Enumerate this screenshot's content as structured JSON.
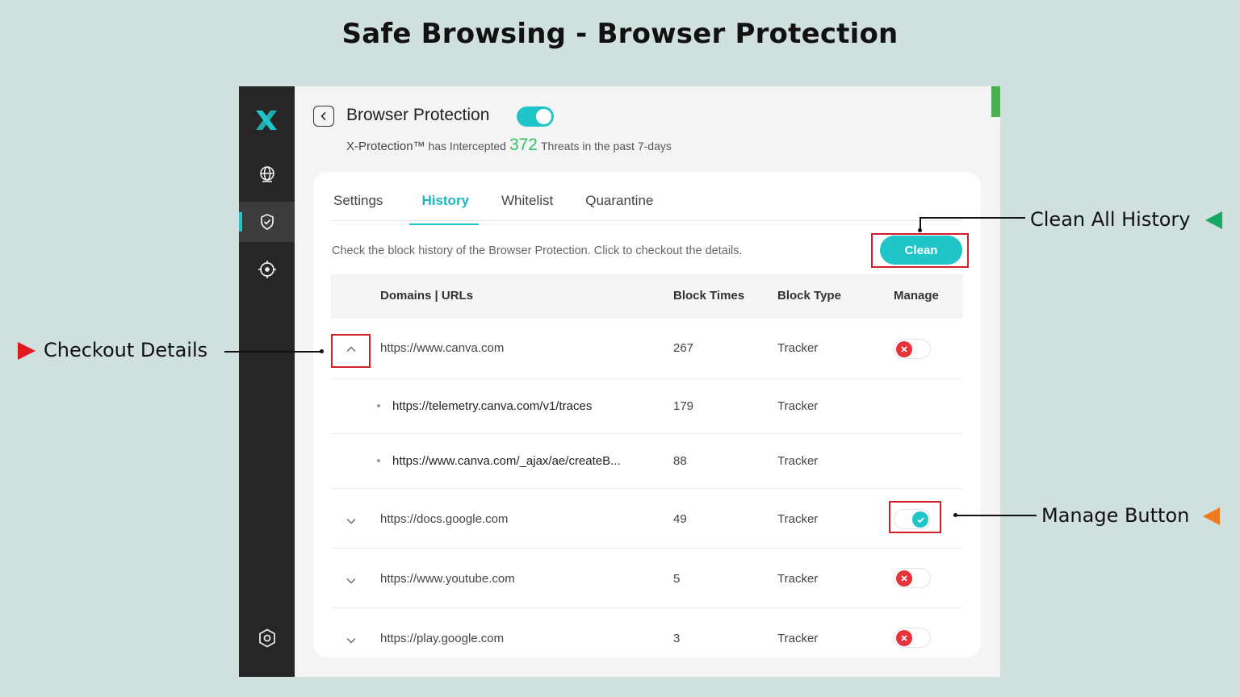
{
  "slide": {
    "title": "Safe Browsing - Browser Protection"
  },
  "colors": {
    "accent": "#20c5c9",
    "count_green": "#35c26a",
    "danger": "#e8323a",
    "annotation_red": "#d0212a"
  },
  "sidebar": {
    "items": [
      {
        "icon": "x-logo-icon"
      },
      {
        "icon": "globe-icon"
      },
      {
        "icon": "shield-check-icon",
        "active": true
      },
      {
        "icon": "crosshair-icon"
      },
      {
        "icon": "settings-hexagon-icon"
      }
    ]
  },
  "header": {
    "title": "Browser Protection",
    "toggle_on": true,
    "sub_brand": "X-Protection™",
    "sub_pre": "has Intercepted",
    "threat_count": "372",
    "sub_post": "Threats in the past 7-days"
  },
  "tabs": [
    {
      "label": "Settings"
    },
    {
      "label": "History",
      "active": true
    },
    {
      "label": "Whitelist"
    },
    {
      "label": "Quarantine"
    }
  ],
  "history": {
    "description": "Check the block history of the Browser Protection. Click to checkout the details.",
    "clean_label": "Clean",
    "columns": {
      "domain": "Domains | URLs",
      "times": "Block Times",
      "type": "Block Type",
      "manage": "Manage"
    },
    "rows": [
      {
        "url": "https://www.canva.com",
        "times": "267",
        "type": "Tracker",
        "expanded": true,
        "manage": "off"
      },
      {
        "url": "https://telemetry.canva.com/v1/traces",
        "times": "179",
        "type": "Tracker",
        "sub": true
      },
      {
        "url": "https://www.canva.com/_ajax/ae/createB...",
        "times": "88",
        "type": "Tracker",
        "sub": true
      },
      {
        "url": "https://docs.google.com",
        "times": "49",
        "type": "Tracker",
        "expanded": false,
        "manage": "on"
      },
      {
        "url": "https://www.youtube.com",
        "times": "5",
        "type": "Tracker",
        "expanded": false,
        "manage": "off"
      },
      {
        "url": "https://play.google.com",
        "times": "3",
        "type": "Tracker",
        "expanded": false,
        "manage": "off"
      }
    ]
  },
  "annotations": {
    "clean_all": "Clean All History",
    "checkout": "Checkout Details",
    "manage": "Manage Button"
  }
}
